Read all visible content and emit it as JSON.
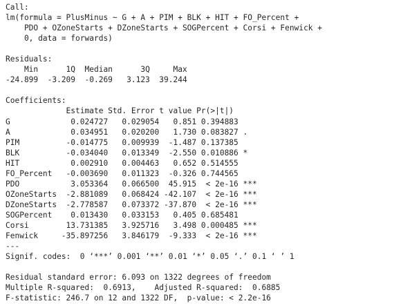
{
  "console": {
    "lines": [
      "Call:",
      "lm(formula = PlusMinus ~ G + A + PIM + BLK + HIT + FO_Percent + ",
      "    PDO + OZoneStarts + DZoneStarts + SOGPercent + Corsi + Fenwick + ",
      "    0, data = forwards)",
      "",
      "Residuals:",
      "    Min      1Q  Median      3Q     Max ",
      "-24.899  -3.209  -0.269   3.123  39.244 ",
      "",
      "Coefficients:",
      "             Estimate Std. Error t value Pr(>|t|)    ",
      "G             0.024727   0.029054   0.851 0.394883    ",
      "A             0.034951   0.020200   1.730 0.083827 .  ",
      "PIM          -0.014775   0.009939  -1.487 0.137385    ",
      "BLK          -0.034040   0.013349  -2.550 0.010886 *  ",
      "HIT           0.002910   0.004463   0.652 0.514555    ",
      "FO_Percent   -0.003690   0.011323  -0.326 0.744565    ",
      "PDO           3.053364   0.066500  45.915  < 2e-16 ***",
      "OZoneStarts  -2.881089   0.068424 -42.107  < 2e-16 ***",
      "DZoneStarts  -2.778587   0.073372 -37.870  < 2e-16 ***",
      "SOGPercent    0.013430   0.033153   0.405 0.685481    ",
      "Corsi        13.731385   3.925716   3.498 0.000485 ***",
      "Fenwick     -35.897256   3.846179  -9.333  < 2e-16 ***",
      "---",
      "Signif. codes:  0 ‘***’ 0.001 ‘**’ 0.01 ‘*’ 0.05 ‘.’ 0.1 ‘ ’ 1",
      "",
      "Residual standard error: 6.093 on 1322 degrees of freedom",
      "Multiple R-squared:  0.6913,\tAdjusted R-squared:  0.6885 ",
      "F-statistic: 246.7 on 12 and 1322 DF,  p-value: < 2.2e-16"
    ]
  }
}
